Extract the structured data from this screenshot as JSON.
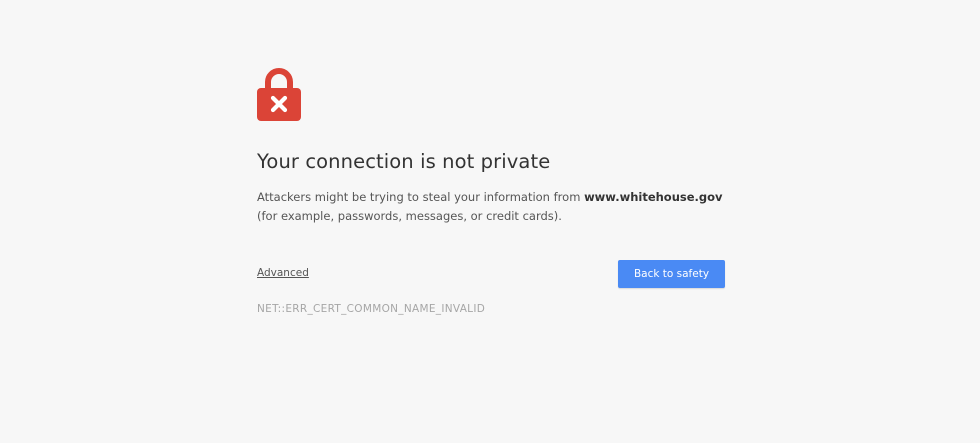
{
  "colors": {
    "background": "#f7f7f7",
    "lock_red": "#db4437",
    "button_blue": "#4a8af4"
  },
  "icon": "lock-with-x-icon",
  "title": "Your connection is not private",
  "description": {
    "prefix": "Attackers might be trying to steal your information from ",
    "domain": "www.whitehouse.gov",
    "suffix": "(for example, passwords, messages, or credit cards)."
  },
  "advanced_label": "Advanced",
  "back_button_label": "Back to safety",
  "error_code": "NET::ERR_CERT_COMMON_NAME_INVALID"
}
